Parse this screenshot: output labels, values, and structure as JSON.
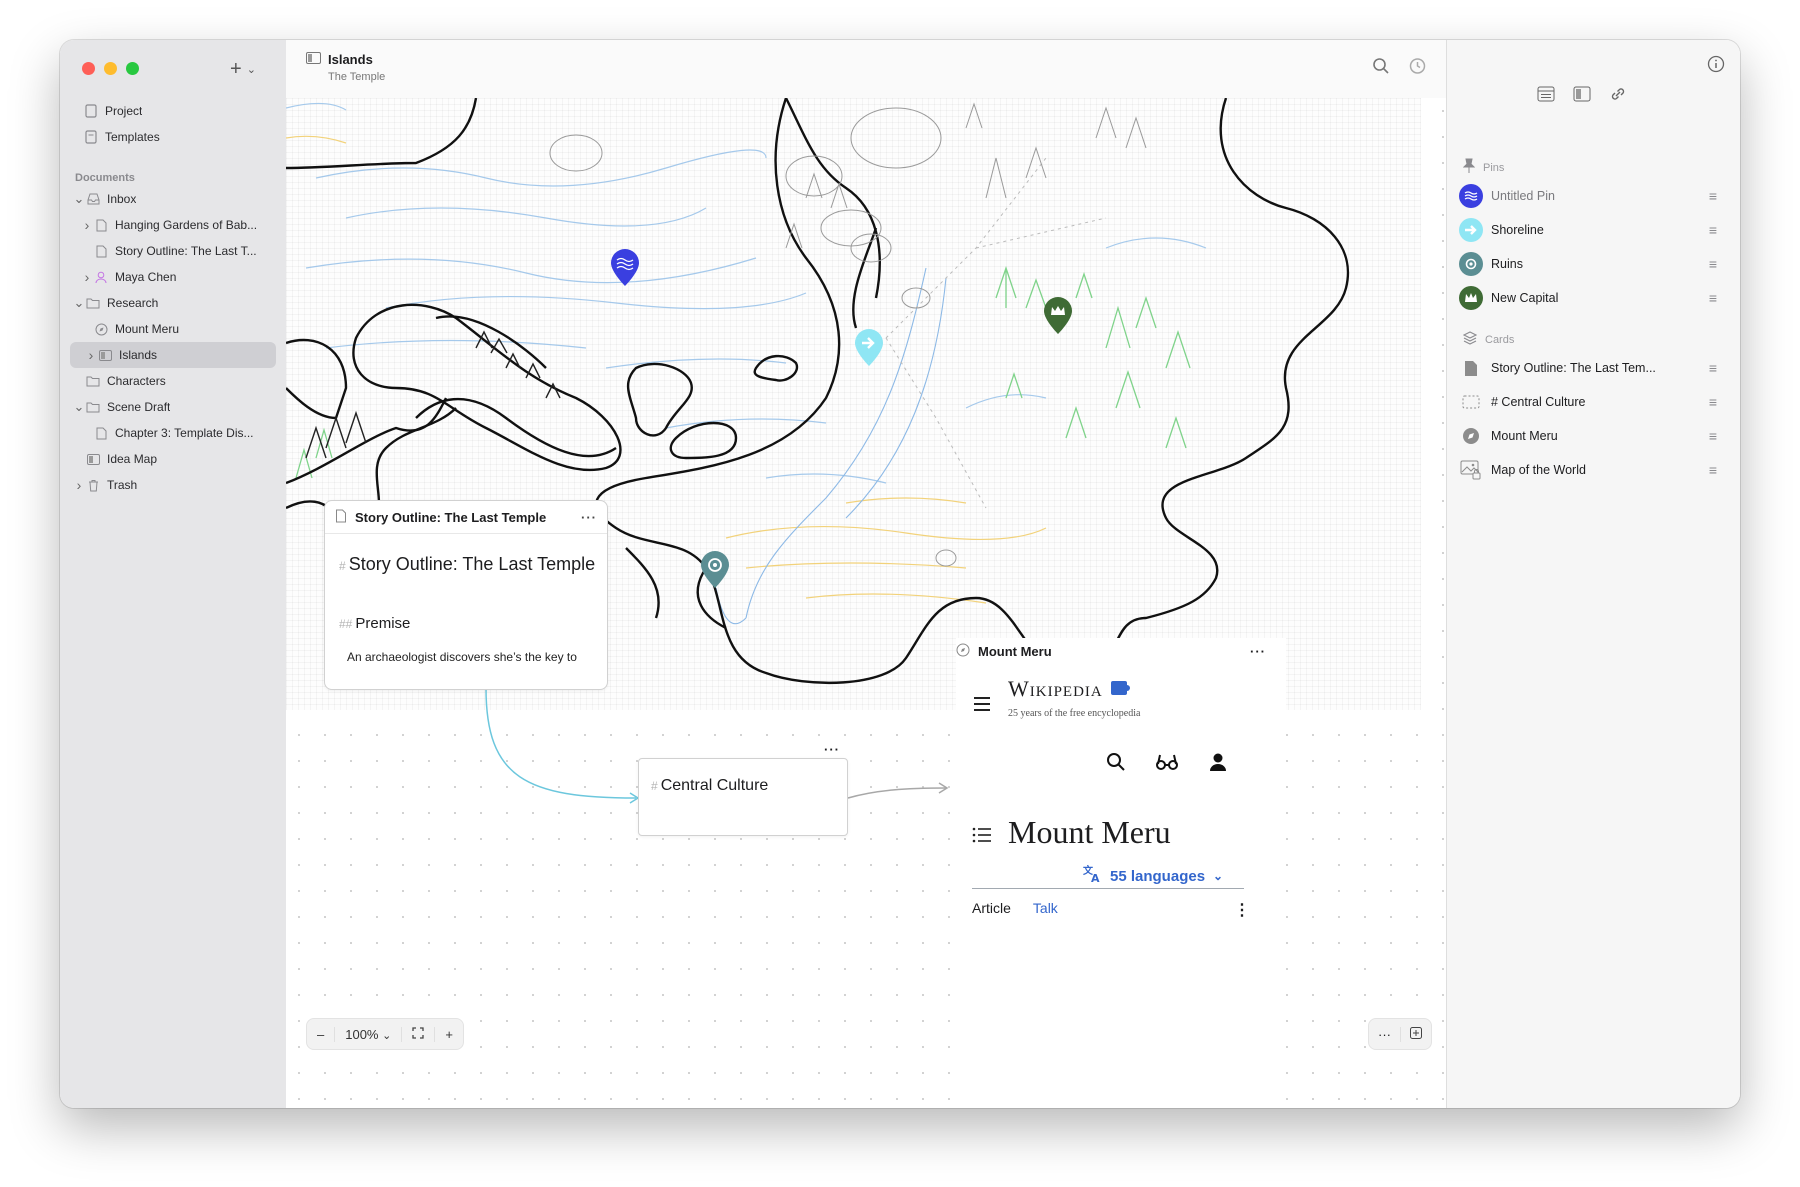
{
  "sidebar": {
    "top_items": [
      {
        "label": "Project"
      },
      {
        "label": "Templates"
      }
    ],
    "documents_header": "Documents",
    "tree": [
      {
        "label": "Inbox",
        "depth": 0,
        "disclosure": "open",
        "icon": "inbox-icon"
      },
      {
        "label": "Hanging Gardens of Bab...",
        "depth": 1,
        "disclosure": "closed",
        "icon": "document-icon"
      },
      {
        "label": "Story Outline: The Last T...",
        "depth": 1,
        "disclosure": "none",
        "icon": "document-icon"
      },
      {
        "label": "Maya Chen",
        "depth": 1,
        "disclosure": "closed",
        "icon": "person-icon"
      },
      {
        "label": "Research",
        "depth": 0,
        "disclosure": "open",
        "icon": "folder-icon"
      },
      {
        "label": "Mount Meru",
        "depth": 1,
        "disclosure": "none",
        "icon": "compass-icon"
      },
      {
        "label": "Islands",
        "depth": 1,
        "disclosure": "closed",
        "icon": "canvas-icon",
        "selected": true
      },
      {
        "label": "Characters",
        "depth": 0,
        "disclosure": "none",
        "icon": "folder-icon"
      },
      {
        "label": "Scene Draft",
        "depth": 0,
        "disclosure": "open",
        "icon": "folder-icon"
      },
      {
        "label": "Chapter 3: Template Dis...",
        "depth": 1,
        "disclosure": "none",
        "icon": "document-icon"
      },
      {
        "label": "Idea Map",
        "depth": 0,
        "disclosure": "none",
        "icon": "canvas-icon"
      },
      {
        "label": "Trash",
        "depth": 0,
        "disclosure": "closed",
        "icon": "trash-icon"
      }
    ]
  },
  "toolbar": {
    "title": "Islands",
    "subtitle": "The Temple"
  },
  "canvas": {
    "story_card": {
      "title": "Story Outline: The Last Temple",
      "h1": "Story Outline: The Last Temple",
      "h2": "Premise",
      "h1_marker": "#",
      "h2_marker": "##",
      "body": "An archaeologist discovers she’s the key to",
      "more": "···"
    },
    "culture_card": {
      "marker": "#",
      "title": "Central Culture",
      "more": "···"
    },
    "wiki_card": {
      "title": "Mount Meru",
      "more": "···",
      "logo": "Wikipedia",
      "tagline": "25 years of the free encyclopedia",
      "article_title": "Mount Meru",
      "languages": "55 languages",
      "tab_article": "Article",
      "tab_talk": "Talk",
      "kebab": "⋮"
    },
    "zoom": {
      "minus": "–",
      "level": "100%",
      "plus": "+"
    },
    "bottom_right_more": "···"
  },
  "inspector": {
    "pins_header": "Pins",
    "pins": [
      {
        "label": "Untitled Pin",
        "color": "#3a3fe0",
        "icon": "waves-icon",
        "muted": true
      },
      {
        "label": "Shoreline",
        "color": "#8fe6f4",
        "icon": "arrow-icon"
      },
      {
        "label": "Ruins",
        "color": "#5b8e93",
        "icon": "ruins-icon"
      },
      {
        "label": "New Capital",
        "color": "#3f6b35",
        "icon": "crown-icon"
      }
    ],
    "cards_header": "Cards",
    "cards": [
      {
        "label": "Story Outline: The Last Tem...",
        "icon": "document-icon"
      },
      {
        "label": "# Central Culture",
        "icon": "dashed-card-icon"
      },
      {
        "label": "Mount Meru",
        "icon": "compass-icon"
      },
      {
        "label": "Map of the World",
        "icon": "image-lock-icon"
      }
    ]
  },
  "colors": {
    "accent_link": "#3366cc",
    "connector": "#6cc7dd"
  }
}
